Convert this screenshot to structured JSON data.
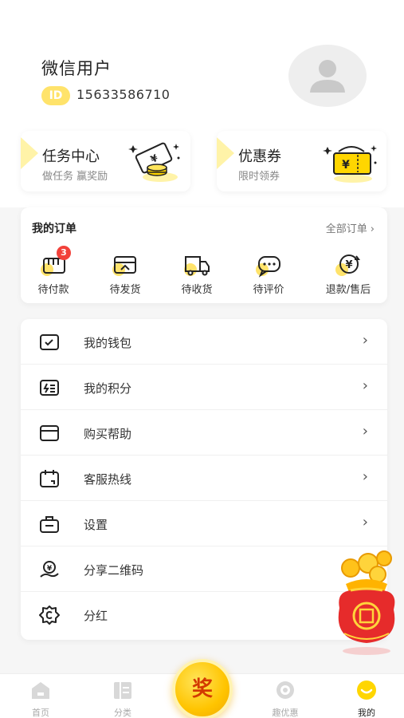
{
  "profile": {
    "nickname": "微信用户",
    "id_badge": "ID",
    "phone": "15633586710"
  },
  "promos": [
    {
      "title": "任务中心",
      "subtitle": "做任务 赢奖励",
      "icon": "coin-ticket-icon"
    },
    {
      "title": "优惠券",
      "subtitle": "限时领券",
      "icon": "yuan-coupon-icon"
    }
  ],
  "orders": {
    "title": "我的订单",
    "all_label": "全部订单",
    "items": [
      {
        "label": "待付款",
        "icon": "wallet-pay-icon",
        "badge": "3"
      },
      {
        "label": "待发货",
        "icon": "package-ship-icon"
      },
      {
        "label": "待收货",
        "icon": "delivery-truck-icon"
      },
      {
        "label": "待评价",
        "icon": "comment-bubble-icon"
      },
      {
        "label": "退款/售后",
        "icon": "refund-yuan-icon"
      }
    ]
  },
  "menu": [
    {
      "label": "我的钱包",
      "icon": "wallet-icon"
    },
    {
      "label": "我的积分",
      "icon": "points-card-icon"
    },
    {
      "label": "购买帮助",
      "icon": "help-card-icon"
    },
    {
      "label": "客服热线",
      "icon": "hotline-calendar-icon"
    },
    {
      "label": "设置",
      "icon": "settings-bag-icon"
    },
    {
      "label": "分享二维码",
      "icon": "share-hand-yuan-icon"
    },
    {
      "label": "分红",
      "icon": "dividend-gear-icon"
    }
  ],
  "center_button": {
    "label": "奖"
  },
  "nav": [
    {
      "label": "首页",
      "icon": "home-icon"
    },
    {
      "label": "分类",
      "icon": "category-icon"
    },
    {
      "label": "趣优惠",
      "icon": "eye-discount-icon"
    },
    {
      "label": "我的",
      "icon": "smile-profile-icon",
      "active": true
    }
  ],
  "colors": {
    "accent_yellow": "#ffd600",
    "badge_red": "#f2413a",
    "background": "#f6f6f6"
  }
}
